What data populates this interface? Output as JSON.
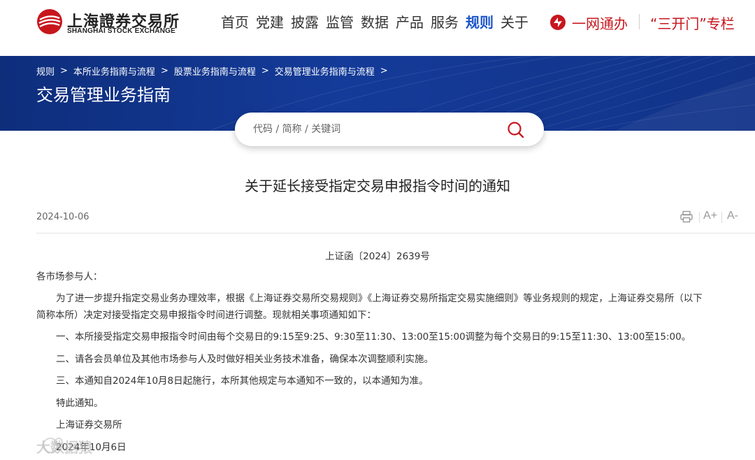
{
  "header": {
    "logo_cn": "上海證券交易所",
    "logo_en": "SHANGHAI STOCK EXCHANGE",
    "nav": [
      {
        "label": "首页",
        "active": false
      },
      {
        "label": "党建",
        "active": false
      },
      {
        "label": "披露",
        "active": false
      },
      {
        "label": "监管",
        "active": false
      },
      {
        "label": "数据",
        "active": false
      },
      {
        "label": "产品",
        "active": false
      },
      {
        "label": "服务",
        "active": false
      },
      {
        "label": "规则",
        "active": true
      },
      {
        "label": "关于",
        "active": false
      }
    ],
    "quick_yiwang": "一网通办",
    "quick_sankai": "“三开门”专栏"
  },
  "banner": {
    "breadcrumb": [
      "规则",
      "本所业务指南与流程",
      "股票业务指南与流程",
      "交易管理业务指南与流程"
    ],
    "title": "交易管理业务指南"
  },
  "search": {
    "placeholder": "代码 / 简称 / 关键词"
  },
  "article": {
    "title": "关于延长接受指定交易申报指令时间的通知",
    "date": "2024-10-06",
    "font_plus": "A+",
    "font_minus": "A-",
    "doc_number": "上证函〔2024〕2639号",
    "salutation": "各市场参与人：",
    "intro_line1": "为了进一步提升指定交易业务办理效率，根据《上海证券交易所交易规则》《上海证券交易所指定交易实施细则》等业务规则的规定，上海证券交易所（以下",
    "intro_line2": "简称本所）决定对接受指定交易申报指令时间进行调整。现就相关事项通知如下：",
    "item1": "一、本所接受指定交易申报指令时间由每个交易日的9:15至9:25、9:30至11:30、13:00至15:00调整为每个交易日的9:15至11:30、13:00至15:00。",
    "item2": "二、请各会员单位及其他市场参与人及时做好相关业务技术准备，确保本次调整顺利实施。",
    "item3": "三、本通知自2024年10月8日起施行，本所其他规定与本通知不一致的，以本通知为准。",
    "closing": "特此通知。",
    "signature": "上海证券交易所",
    "sign_date": "2024年10月6日"
  },
  "watermark": {
    "text": "大数据猿"
  },
  "colors": {
    "brand_red": "#c8161d",
    "nav_active_blue": "#1b55c8",
    "banner_blue": "#143b99"
  },
  "icons": [
    "sse-logo-icon",
    "yiwang-logo-icon",
    "search-icon",
    "print-icon",
    "chevron-right-icon"
  ]
}
